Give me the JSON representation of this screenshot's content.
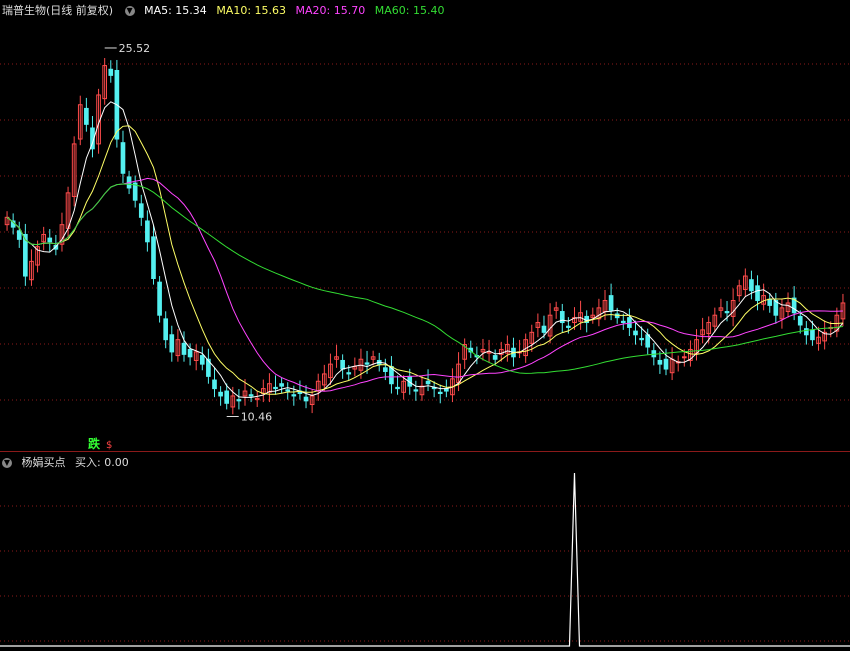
{
  "header": {
    "title": "瑞普生物(日线 前复权)",
    "ma5": "MA5: 15.34",
    "ma10": "MA10: 15.63",
    "ma20": "MA20: 15.70",
    "ma60": "MA60: 15.40"
  },
  "colors": {
    "up": "#ff4b4b",
    "down": "#54f0f0",
    "ma5": "#ffffff",
    "ma10": "#ffff66",
    "ma20": "#ff44ff",
    "ma60": "#33dd33",
    "grid": "#8b1a1a"
  },
  "annotations": {
    "high": "25.52",
    "low": "10.46",
    "signal_tag": "跌",
    "small_tag": "$"
  },
  "indicator": {
    "name": "杨娟买点",
    "value": "买入: 0.00"
  },
  "chart_data": [
    {
      "type": "candlestick",
      "title": "瑞普生物(日线 前复权)",
      "ylim": [
        9.5,
        26.5
      ],
      "high_label": 25.52,
      "low_label": 10.46,
      "series": [
        {
          "name": "MA5",
          "latest": 15.34
        },
        {
          "name": "MA10",
          "latest": 15.63
        },
        {
          "name": "MA20",
          "latest": 15.7
        },
        {
          "name": "MA60",
          "latest": 15.4
        }
      ],
      "closes": [
        18.6,
        18.2,
        17.7,
        16.2,
        16.8,
        17.4,
        17.9,
        17.6,
        17.3,
        18.3,
        19.6,
        21.6,
        23.2,
        22.4,
        21.4,
        23.6,
        24.8,
        24.4,
        21.8,
        20.4,
        19.8,
        19.3,
        18.6,
        17.6,
        16.1,
        14.6,
        13.6,
        13.1,
        13.6,
        13.0,
        12.9,
        13.1,
        12.6,
        12.1,
        11.6,
        11.3,
        11.0,
        11.3,
        11.1,
        11.5,
        11.3,
        11.2,
        11.6,
        11.8,
        11.6,
        11.7,
        11.5,
        11.3,
        11.4,
        11.1,
        11.3,
        11.9,
        12.2,
        12.6,
        12.9,
        12.4,
        12.2,
        12.5,
        12.8,
        12.6,
        12.9,
        12.6,
        12.3,
        11.8,
        11.6,
        11.9,
        11.7,
        11.5,
        11.7,
        11.8,
        11.6,
        11.4,
        11.5,
        12.0,
        12.6,
        13.4,
        13.1,
        12.9,
        13.2,
        13.1,
        12.8,
        13.2,
        13.4,
        12.9,
        13.1,
        13.6,
        13.9,
        14.3,
        13.9,
        14.6,
        14.9,
        14.3,
        14.1,
        14.5,
        14.7,
        14.3,
        14.6,
        14.9,
        15.2,
        14.8,
        14.5,
        14.3,
        14.1,
        13.8,
        13.6,
        13.3,
        12.9,
        12.6,
        12.4,
        12.8,
        12.7,
        12.9,
        13.2,
        13.6,
        14.0,
        14.3,
        14.6,
        14.9,
        14.7,
        15.2,
        15.8,
        16.2,
        15.6,
        15.2,
        15.4,
        15.0,
        14.6,
        14.9,
        15.1,
        14.7,
        14.2,
        13.8,
        13.6,
        13.7,
        13.9,
        14.1,
        14.6,
        15.1
      ],
      "indicator": {
        "name": "杨娟买点",
        "latest": 0.0,
        "spike_index": 93,
        "spike_value": 1.0
      }
    }
  ]
}
